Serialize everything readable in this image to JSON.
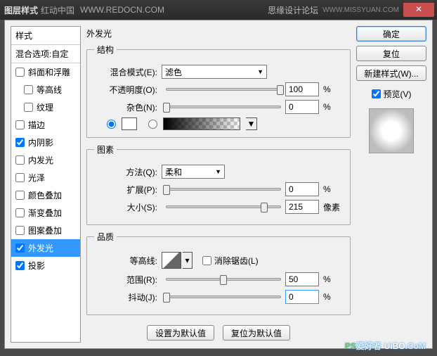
{
  "titlebar": {
    "title": "图层样式",
    "brand": "红动中国",
    "url": "WWW.REDOCN.COM",
    "forum": "思缘设计论坛",
    "forum_url": "WWW.MISSYUAN.COM",
    "close_glyph": "✕"
  },
  "styles_panel": {
    "header": "样式",
    "subheader": "混合选项:自定",
    "items": [
      {
        "label": "斜面和浮雕",
        "checked": false,
        "indent": false
      },
      {
        "label": "等高线",
        "checked": false,
        "indent": true
      },
      {
        "label": "纹理",
        "checked": false,
        "indent": true
      },
      {
        "label": "描边",
        "checked": false,
        "indent": false
      },
      {
        "label": "内阴影",
        "checked": true,
        "indent": false
      },
      {
        "label": "内发光",
        "checked": false,
        "indent": false
      },
      {
        "label": "光泽",
        "checked": false,
        "indent": false
      },
      {
        "label": "颜色叠加",
        "checked": false,
        "indent": false
      },
      {
        "label": "渐变叠加",
        "checked": false,
        "indent": false
      },
      {
        "label": "图案叠加",
        "checked": false,
        "indent": false
      },
      {
        "label": "外发光",
        "checked": true,
        "indent": false,
        "selected": true
      },
      {
        "label": "投影",
        "checked": true,
        "indent": false
      }
    ]
  },
  "section_title": "外发光",
  "structure": {
    "legend": "结构",
    "blend_label": "混合模式(E):",
    "blend_value": "滤色",
    "opacity_label": "不透明度(O):",
    "opacity_value": "100",
    "opacity_unit": "%",
    "noise_label": "杂色(N):",
    "noise_value": "0",
    "noise_unit": "%"
  },
  "elements": {
    "legend": "图素",
    "method_label": "方法(Q):",
    "method_value": "柔和",
    "spread_label": "扩展(P):",
    "spread_value": "0",
    "spread_unit": "%",
    "size_label": "大小(S):",
    "size_value": "215",
    "size_unit": "像素"
  },
  "quality": {
    "legend": "品质",
    "contour_label": "等高线:",
    "antialias_label": "消除锯齿(L)",
    "range_label": "范围(R):",
    "range_value": "50",
    "range_unit": "%",
    "jitter_label": "抖动(J):",
    "jitter_value": "0",
    "jitter_unit": "%"
  },
  "buttons": {
    "make_default": "设置为默认值",
    "reset_default": "复位为默认值",
    "ok": "确定",
    "cancel": "复位",
    "new_style": "新建样式(W)...",
    "preview": "预览(V)"
  },
  "footer": {
    "ps": "PS",
    "love": "爱好者",
    "u": "UiBO",
    "dot": ".",
    "com": "CoM"
  }
}
